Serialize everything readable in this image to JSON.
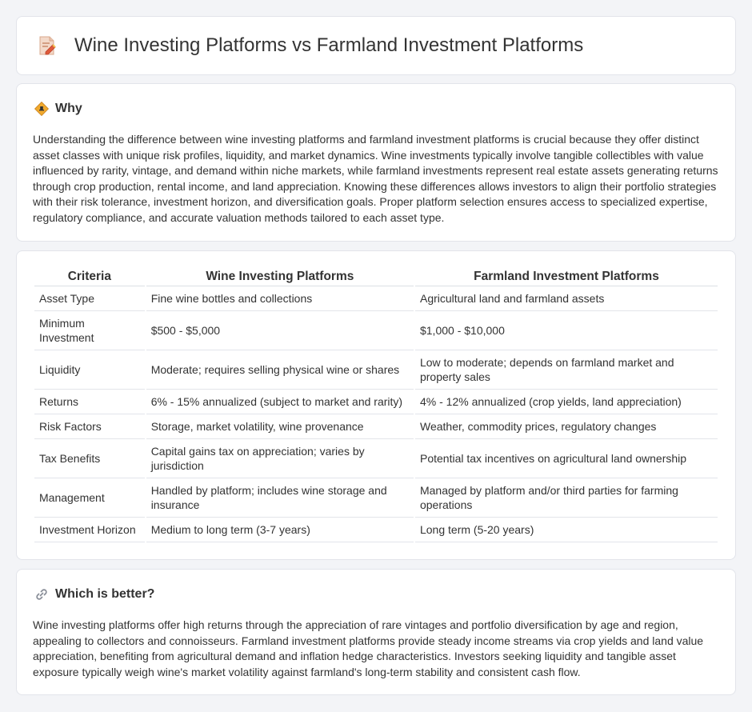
{
  "header": {
    "title": "Wine Investing Platforms vs Farmland Investment Platforms",
    "icon": "document-edit-icon"
  },
  "why": {
    "title": "Why",
    "icon": "road-sign-icon",
    "body": "Understanding the difference between wine investing platforms and farmland investment platforms is crucial because they offer distinct asset classes with unique risk profiles, liquidity, and market dynamics. Wine investments typically involve tangible collectibles with value influenced by rarity, vintage, and demand within niche markets, while farmland investments represent real estate assets generating returns through crop production, rental income, and land appreciation. Knowing these differences allows investors to align their portfolio strategies with their risk tolerance, investment horizon, and diversification goals. Proper platform selection ensures access to specialized expertise, regulatory compliance, and accurate valuation methods tailored to each asset type."
  },
  "table": {
    "headers": [
      "Criteria",
      "Wine Investing Platforms",
      "Farmland Investment Platforms"
    ],
    "rows": [
      [
        "Asset Type",
        "Fine wine bottles and collections",
        "Agricultural land and farmland assets"
      ],
      [
        "Minimum Investment",
        "$500 - $5,000",
        "$1,000 - $10,000"
      ],
      [
        "Liquidity",
        "Moderate; requires selling physical wine or shares",
        "Low to moderate; depends on farmland market and property sales"
      ],
      [
        "Returns",
        "6% - 15% annualized (subject to market and rarity)",
        "4% - 12% annualized (crop yields, land appreciation)"
      ],
      [
        "Risk Factors",
        "Storage, market volatility, wine provenance",
        "Weather, commodity prices, regulatory changes"
      ],
      [
        "Tax Benefits",
        "Capital gains tax on appreciation; varies by jurisdiction",
        "Potential tax incentives on agricultural land ownership"
      ],
      [
        "Management",
        "Handled by platform; includes wine storage and insurance",
        "Managed by platform and/or third parties for farming operations"
      ],
      [
        "Investment Horizon",
        "Medium to long term (3-7 years)",
        "Long term (5-20 years)"
      ]
    ]
  },
  "better": {
    "title": "Which is better?",
    "icon": "link-icon",
    "body": "Wine investing platforms offer high returns through the appreciation of rare vintages and portfolio diversification by age and region, appealing to collectors and connoisseurs. Farmland investment platforms provide steady income streams via crop yields and land value appreciation, benefiting from agricultural demand and inflation hedge characteristics. Investors seeking liquidity and tangible asset exposure typically weigh wine's market volatility against farmland's long-term stability and consistent cash flow."
  }
}
